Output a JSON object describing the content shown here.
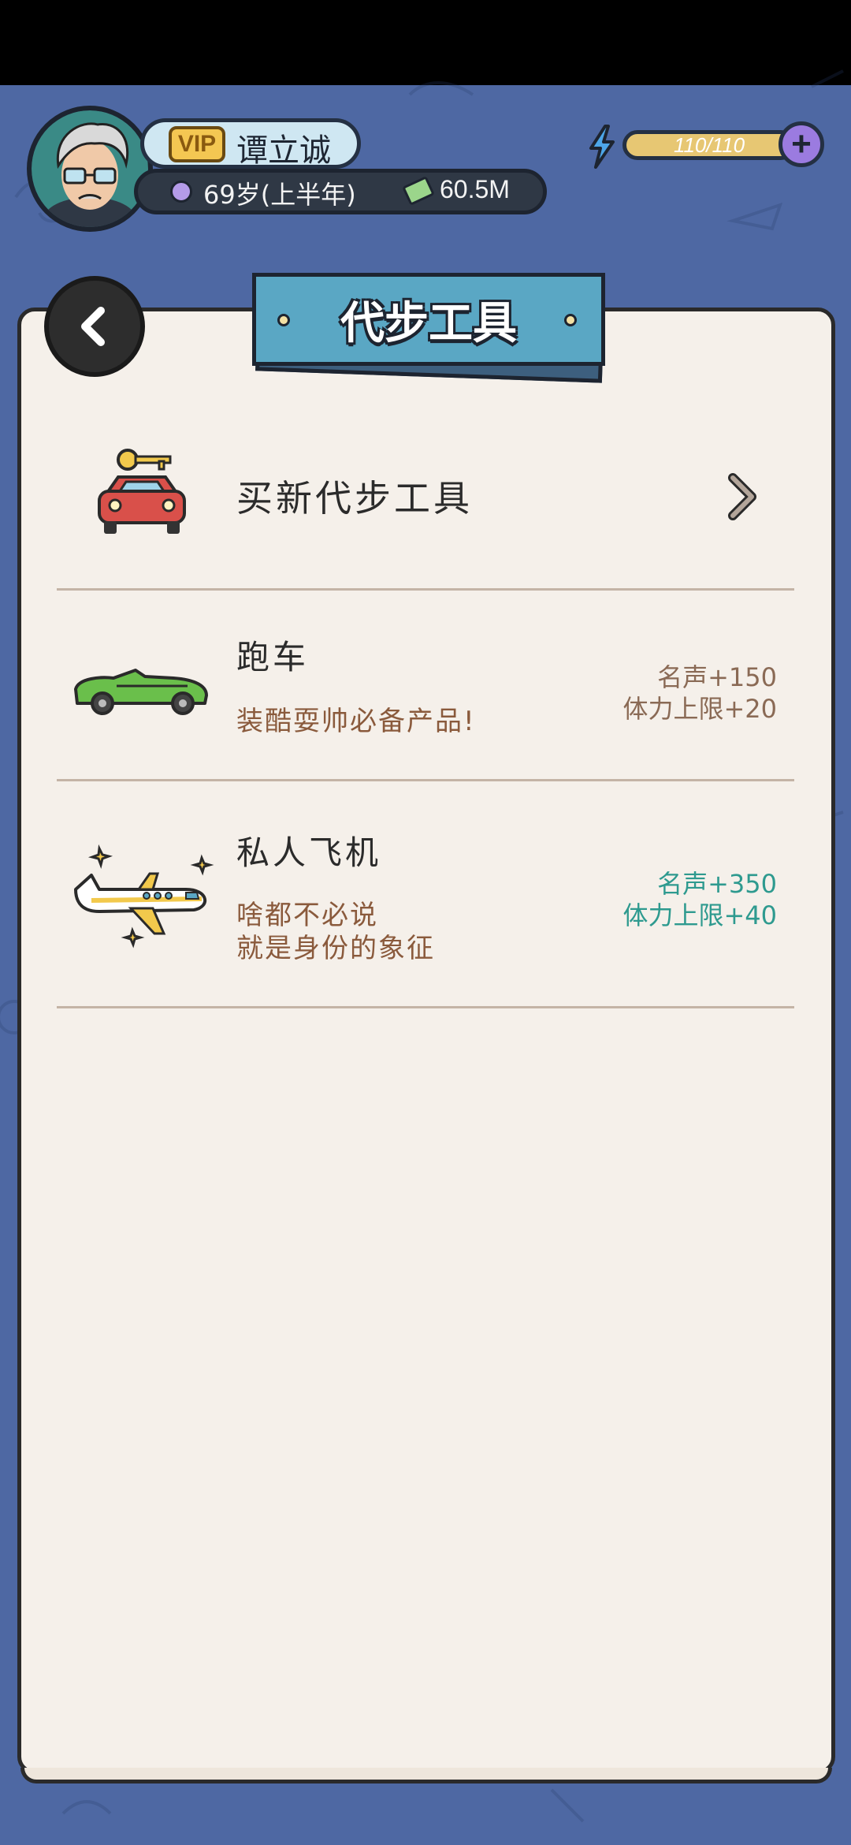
{
  "player": {
    "vip_label": "VIP",
    "name": "谭立诚",
    "age": "69岁(上半年)",
    "money": "60.5M",
    "energy": "110/110",
    "energy_add": "+"
  },
  "page": {
    "title": "代步工具"
  },
  "buy_row": {
    "label": "买新代步工具"
  },
  "items": [
    {
      "name": "跑车",
      "desc_line1": "装酷耍帅必备产品!",
      "desc_line2": "",
      "stat1": "名声+150",
      "stat2": "体力上限+20",
      "stat_color": "#8a6a55"
    },
    {
      "name": "私人飞机",
      "desc_line1": "啥都不必说",
      "desc_line2": "就是身份的象征",
      "stat1": "名声+350",
      "stat2": "体力上限+40",
      "stat_color": "#2e9a8f"
    }
  ]
}
